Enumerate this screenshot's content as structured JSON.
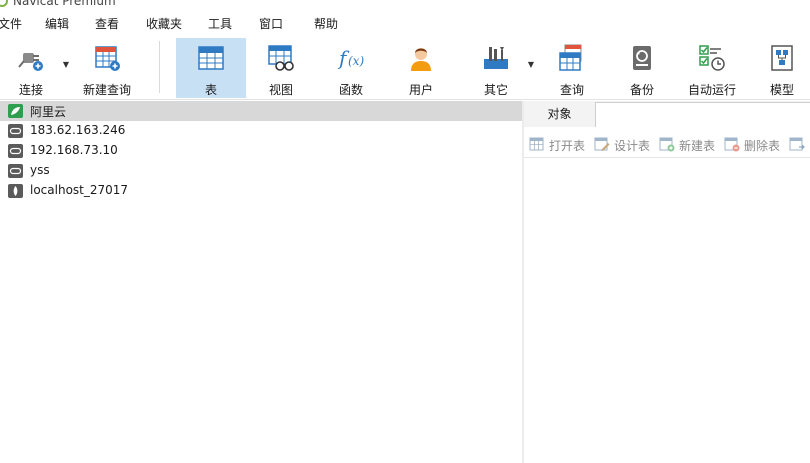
{
  "window": {
    "title": "Navicat Premium"
  },
  "menu": [
    "文件",
    "编辑",
    "查看",
    "收藏夹",
    "工具",
    "窗口",
    "帮助"
  ],
  "toolbar": {
    "connect": "连接",
    "new_query": "新建查询",
    "table": "表",
    "view": "视图",
    "function": "函数",
    "user": "用户",
    "other": "其它",
    "query": "查询",
    "backup": "备份",
    "automation": "自动运行",
    "model": "模型"
  },
  "connections": [
    {
      "label": "阿里云",
      "icon": "mysql-leaf-icon",
      "selected": true
    },
    {
      "label": "183.62.163.246",
      "icon": "server-icon"
    },
    {
      "label": "192.168.73.10",
      "icon": "server-icon"
    },
    {
      "label": "yss",
      "icon": "server-icon"
    },
    {
      "label": "localhost_27017",
      "icon": "mongodb-leaf-icon"
    }
  ],
  "object_panel": {
    "tab_label": "对象",
    "actions": [
      "打开表",
      "设计表",
      "新建表",
      "删除表"
    ]
  },
  "colors": {
    "active_tool_bg": "#c7e0f4",
    "selected_row_bg": "#d8d8d8",
    "accent_blue": "#2e7bc4",
    "accent_red": "#e0533d"
  }
}
